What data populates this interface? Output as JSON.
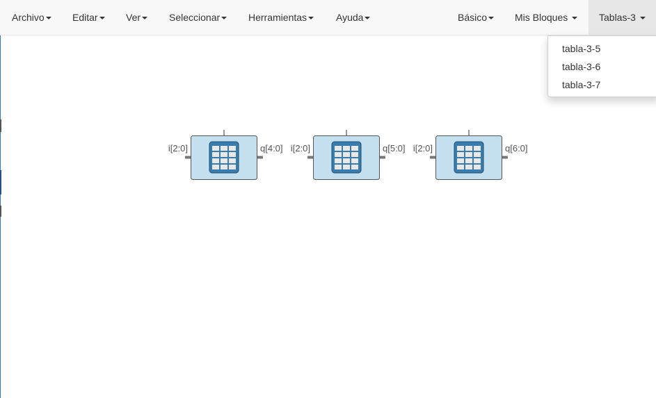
{
  "menu": {
    "left": [
      {
        "label": "Archivo",
        "caret": true
      },
      {
        "label": "Editar",
        "caret": true
      },
      {
        "label": "Ver",
        "caret": true
      },
      {
        "label": "Seleccionar",
        "caret": true
      },
      {
        "label": "Herramientas",
        "caret": true
      },
      {
        "label": "Ayuda",
        "caret": true
      }
    ],
    "right": [
      {
        "label": "Básico",
        "caret": true
      },
      {
        "label": "Mis Bloques",
        "caret": true
      },
      {
        "label": "Tablas-3",
        "caret": true,
        "active": true
      }
    ]
  },
  "dropdown": {
    "items": [
      "tabla-3-5",
      "tabla-3-6",
      "tabla-3-7"
    ]
  },
  "blocks": [
    {
      "input_label": "i[2:0]",
      "output_label": "q[4:0]",
      "icon": "table-icon"
    },
    {
      "input_label": "i[2:0]",
      "output_label": "q[5:0]",
      "icon": "table-icon"
    },
    {
      "input_label": "i[2:0]",
      "output_label": "q[6:0]",
      "icon": "table-icon"
    }
  ],
  "colors": {
    "navbar_bg": "#f8f8f8",
    "active_bg": "#e7e7e7",
    "block_fill": "#c4e0ee",
    "icon_fill": "#3a7cae",
    "icon_cell": "#e8e8e8",
    "port": "#777777"
  }
}
